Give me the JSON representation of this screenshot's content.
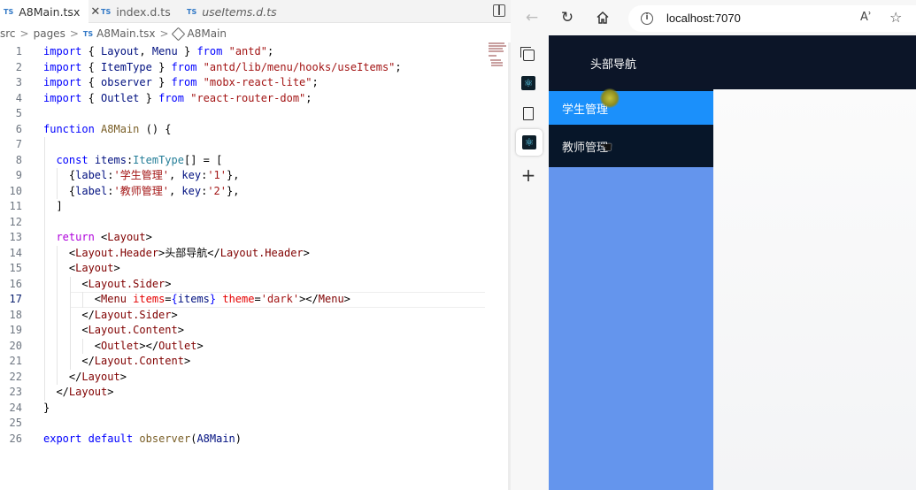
{
  "editor": {
    "tabs": [
      {
        "badge": "TS",
        "label": "A8Main.tsx",
        "active": true,
        "close": "✕"
      },
      {
        "badge": "TS",
        "label": "index.d.ts",
        "active": false
      },
      {
        "badge": "TS",
        "label": "useItems.d.ts",
        "active": false,
        "italic": true
      }
    ],
    "breadcrumb": {
      "parts": [
        "src",
        "pages"
      ],
      "file_badge": "TS",
      "file": "A8Main.tsx",
      "symbol": "A8Main",
      "separator": ">"
    },
    "line_numbers": [
      "1",
      "2",
      "3",
      "4",
      "5",
      "6",
      "7",
      "8",
      "9",
      "10",
      "11",
      "12",
      "13",
      "14",
      "15",
      "16",
      "17",
      "18",
      "19",
      "20",
      "21",
      "22",
      "23",
      "24",
      "25",
      "26"
    ],
    "active_line": 17
  },
  "browser": {
    "url": "localhost:7070",
    "read_aloud_label": "Aʾ",
    "icons": {
      "back": "arrow-left",
      "refresh": "refresh",
      "home": "home",
      "info": "info",
      "favorite": "star-plus",
      "tabs": "tab-actions",
      "react": "react",
      "page": "page",
      "add": "plus"
    },
    "page": {
      "header_text": "头部导航",
      "menu": [
        {
          "label": "学生管理",
          "selected": true
        },
        {
          "label": "教师管理",
          "selected": false
        }
      ]
    },
    "colors": {
      "header_bg": "#0c1528",
      "menu_bg": "#071629",
      "menu_selected": "#1b90fb",
      "sider_bg": "#6495ed"
    }
  }
}
